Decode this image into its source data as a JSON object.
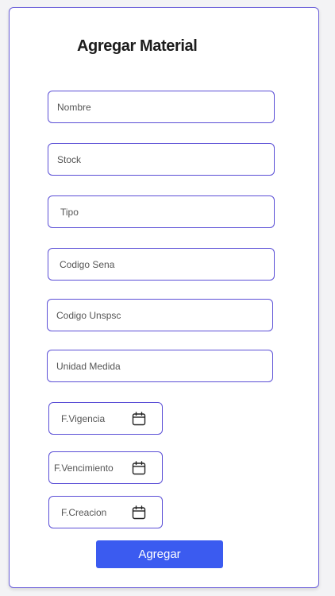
{
  "form": {
    "title": "Agregar Material",
    "fields": {
      "nombre": "Nombre",
      "stock": "Stock",
      "tipo": "Tipo",
      "codigo_sena": "Codigo Sena",
      "codigo_unspsc": "Codigo Unspsc",
      "unidad_medida": "Unidad Medida",
      "f_vigencia": "F.Vigencia",
      "f_vencimiento": "F.Vencimiento",
      "f_creacion": "F.Creacion"
    },
    "submit_label": "Agregar"
  },
  "icons": {
    "date_picker": "calendar-icon"
  },
  "colors": {
    "field_border": "#5b4fd6",
    "button_bg": "#3b5bf0",
    "card_border": "#6b5fd9"
  }
}
